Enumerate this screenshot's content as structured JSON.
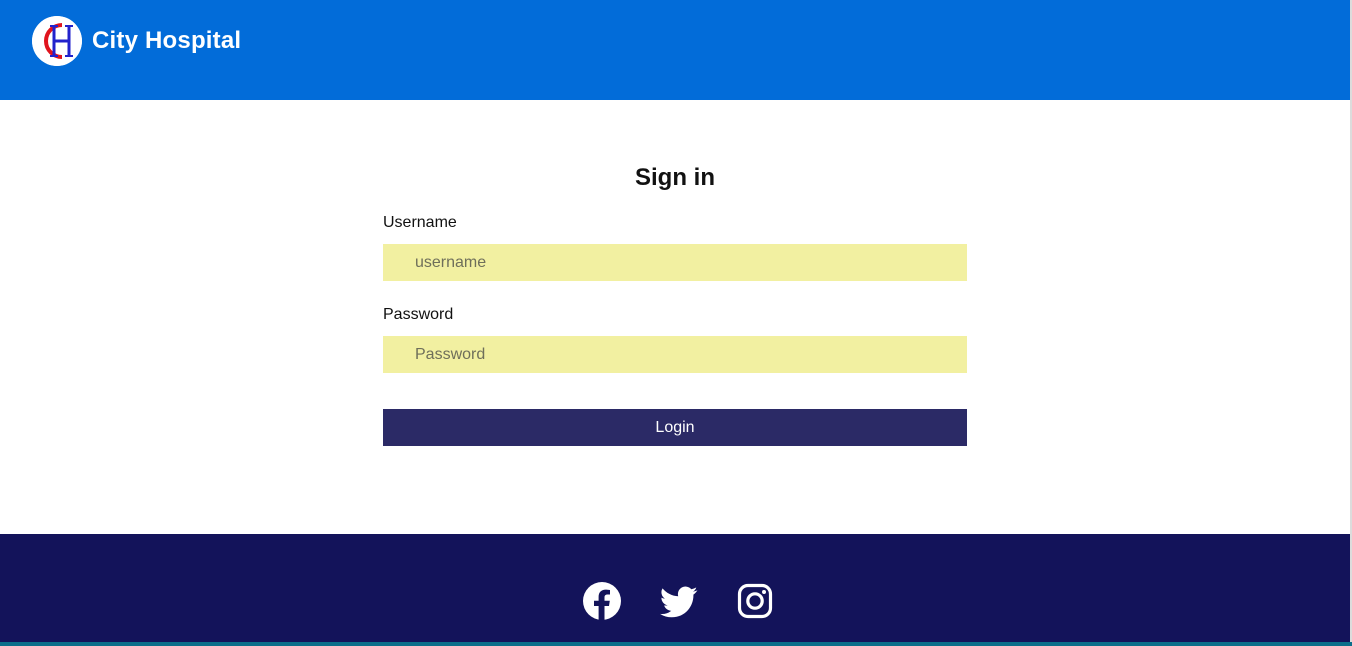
{
  "header": {
    "brand_name": "City Hospital",
    "logo_letters": "CH",
    "background_color": "#026cd9"
  },
  "signin": {
    "title": "Sign in",
    "username_label": "Username",
    "username_placeholder": "username",
    "password_label": "Password",
    "password_placeholder": "Password",
    "login_label": "Login"
  },
  "footer": {
    "background_color": "#13135a",
    "social_icons": [
      "facebook-icon",
      "twitter-icon",
      "instagram-icon"
    ]
  },
  "colors": {
    "input_background": "#f2f0a1",
    "button_background": "#2b2a66"
  }
}
